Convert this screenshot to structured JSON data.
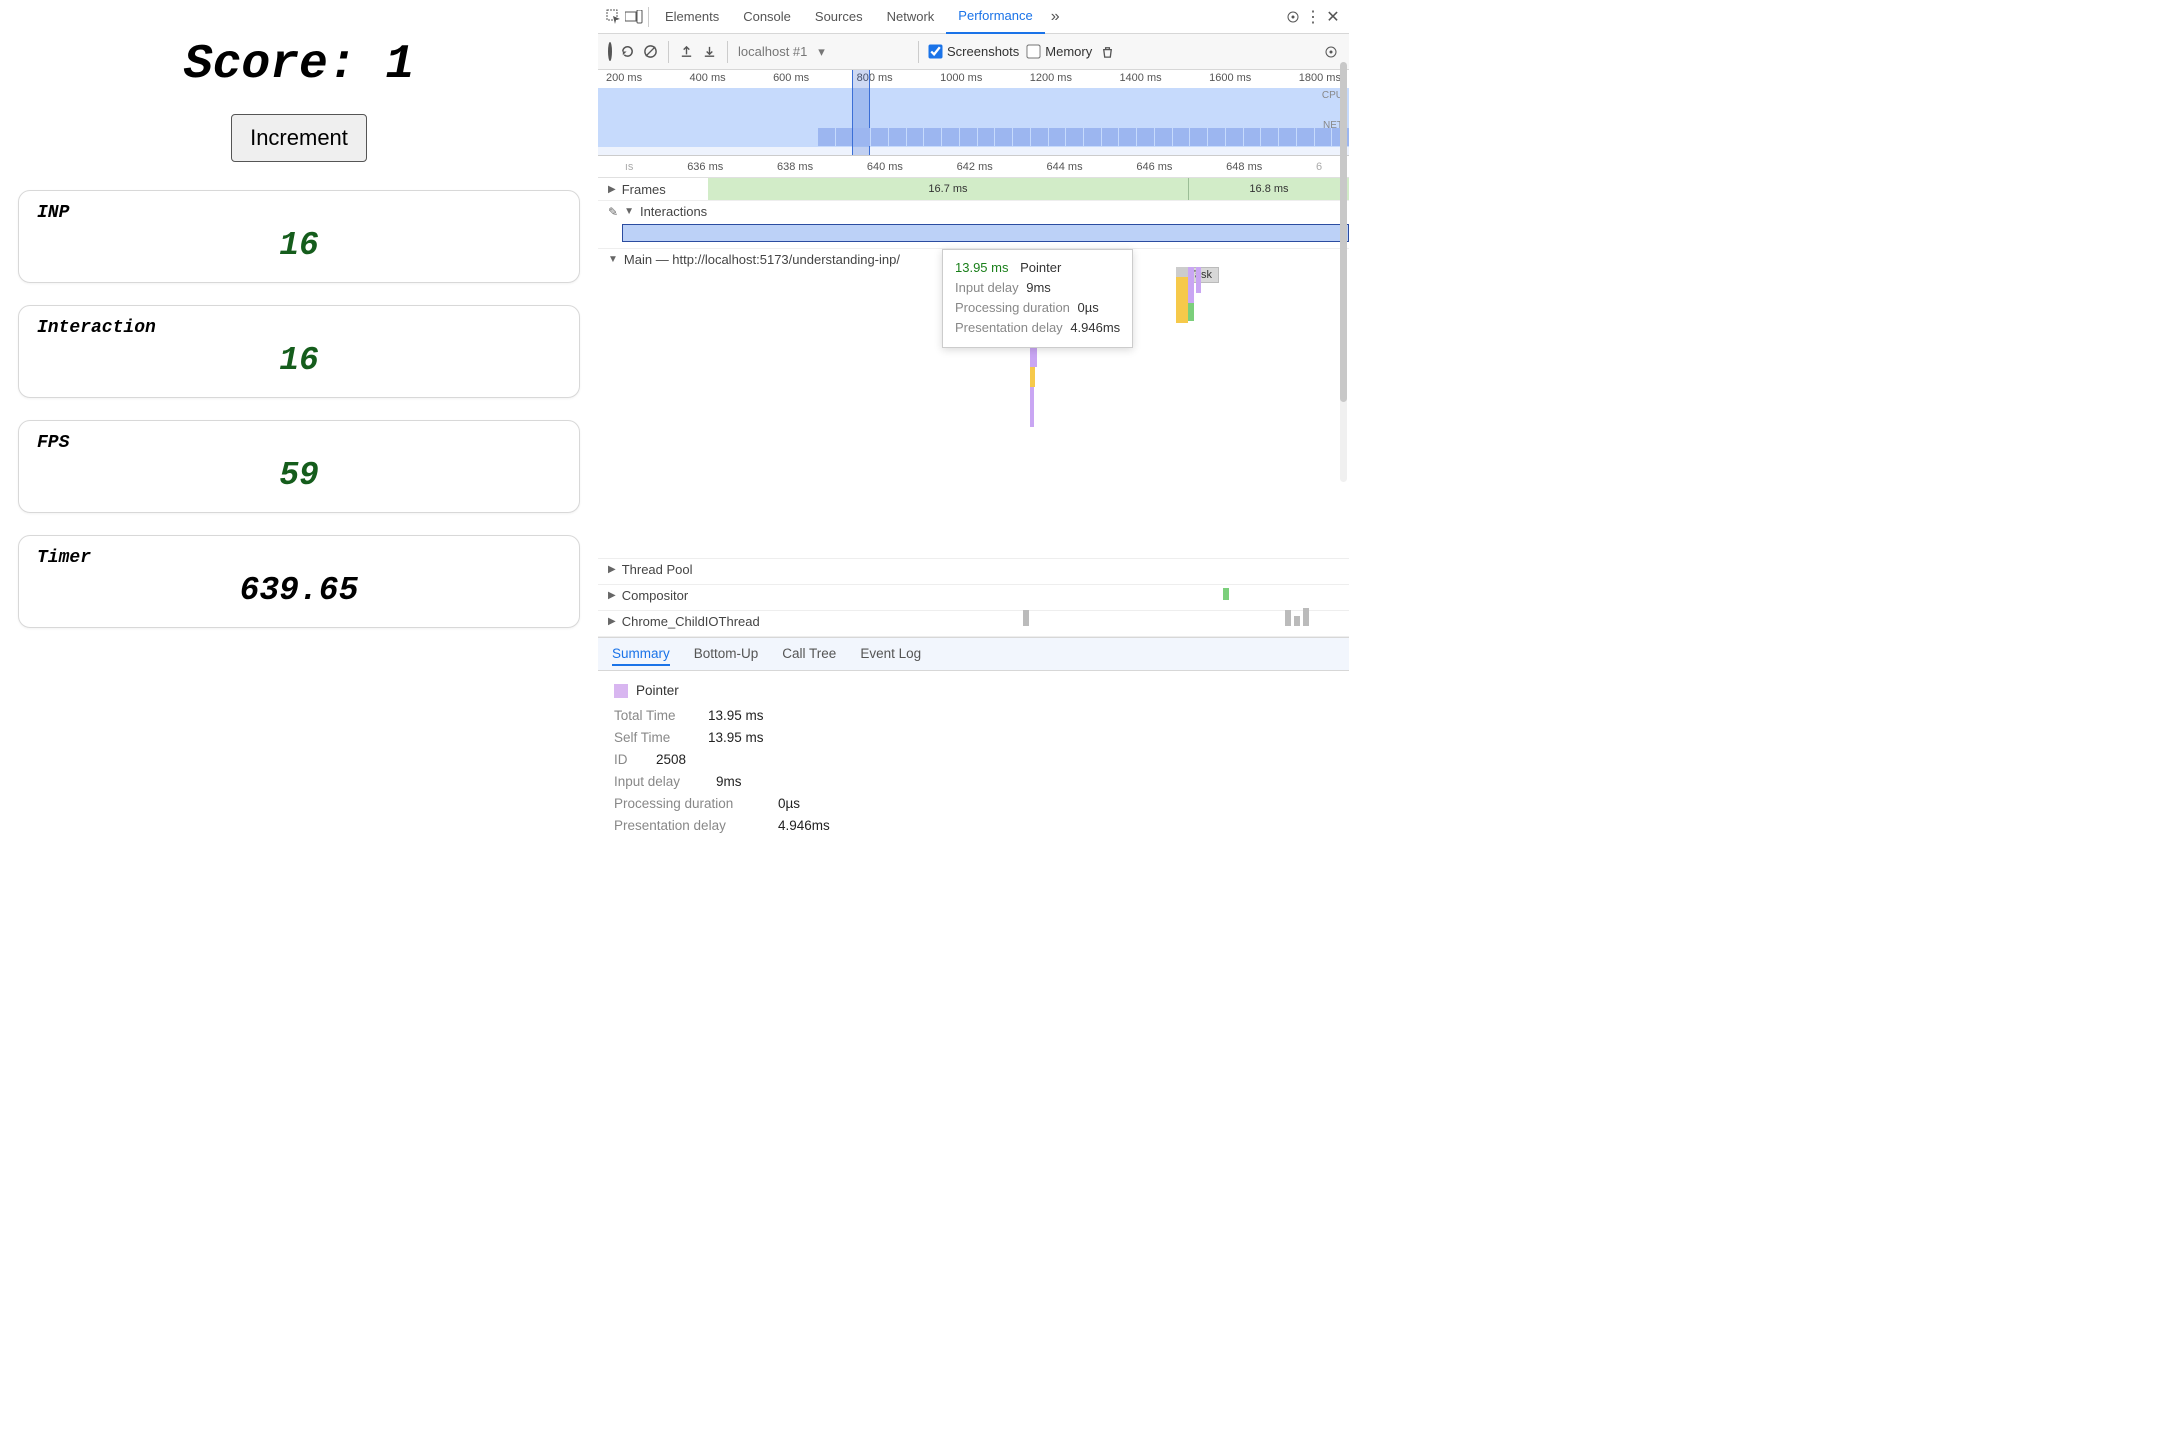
{
  "app": {
    "score_label_full": "Score: 1",
    "increment_label": "Increment",
    "cards": {
      "inp": {
        "label": "INP",
        "value": "16"
      },
      "interaction": {
        "label": "Interaction",
        "value": "16"
      },
      "fps": {
        "label": "FPS",
        "value": "59"
      },
      "timer": {
        "label": "Timer",
        "value": "639.65"
      }
    }
  },
  "devtools": {
    "tabs": {
      "elements": "Elements",
      "console": "Console",
      "sources": "Sources",
      "network": "Network",
      "performance": "Performance",
      "more": "»"
    },
    "toolbar": {
      "recording_source": "localhost #1",
      "screenshots_label": "Screenshots",
      "memory_label": "Memory"
    },
    "overview_ticks": [
      "200 ms",
      "400 ms",
      "600 ms",
      "800 ms",
      "1000 ms",
      "1200 ms",
      "1400 ms",
      "1600 ms",
      "1800 ms"
    ],
    "overview_labels": {
      "cpu": "CPU",
      "net": "NET"
    },
    "detail_ticks": [
      "ıs",
      "636 ms",
      "638 ms",
      "640 ms",
      "642 ms",
      "644 ms",
      "646 ms",
      "648 ms",
      "6"
    ],
    "tracks": {
      "frames": {
        "label": "Frames",
        "times": [
          "16.7 ms",
          "16.8 ms"
        ]
      },
      "interactions": {
        "label": "Interactions"
      },
      "main": {
        "label": "Main — http://localhost:5173/understanding-inp/",
        "task_label": "Task"
      },
      "threadpool": "Thread Pool",
      "compositor": "Compositor",
      "child_io": "Chrome_ChildIOThread"
    },
    "tooltip": {
      "duration": "13.95 ms",
      "type": "Pointer",
      "input_delay_label": "Input delay",
      "input_delay_value": "9ms",
      "processing_label": "Processing duration",
      "processing_value": "0µs",
      "presentation_label": "Presentation delay",
      "presentation_value": "4.946ms"
    },
    "summary_tabs": {
      "summary": "Summary",
      "bottom_up": "Bottom-Up",
      "call_tree": "Call Tree",
      "event_log": "Event Log"
    },
    "summary": {
      "pointer": "Pointer",
      "rows": {
        "total_time": {
          "k": "Total Time",
          "v": "13.95 ms"
        },
        "self_time": {
          "k": "Self Time",
          "v": "13.95 ms"
        },
        "id": {
          "k": "ID",
          "v": "2508"
        },
        "input_delay": {
          "k": "Input delay",
          "v": "9ms"
        },
        "processing": {
          "k": "Processing duration",
          "v": "0µs"
        },
        "presentation": {
          "k": "Presentation delay",
          "v": "4.946ms"
        }
      }
    }
  }
}
